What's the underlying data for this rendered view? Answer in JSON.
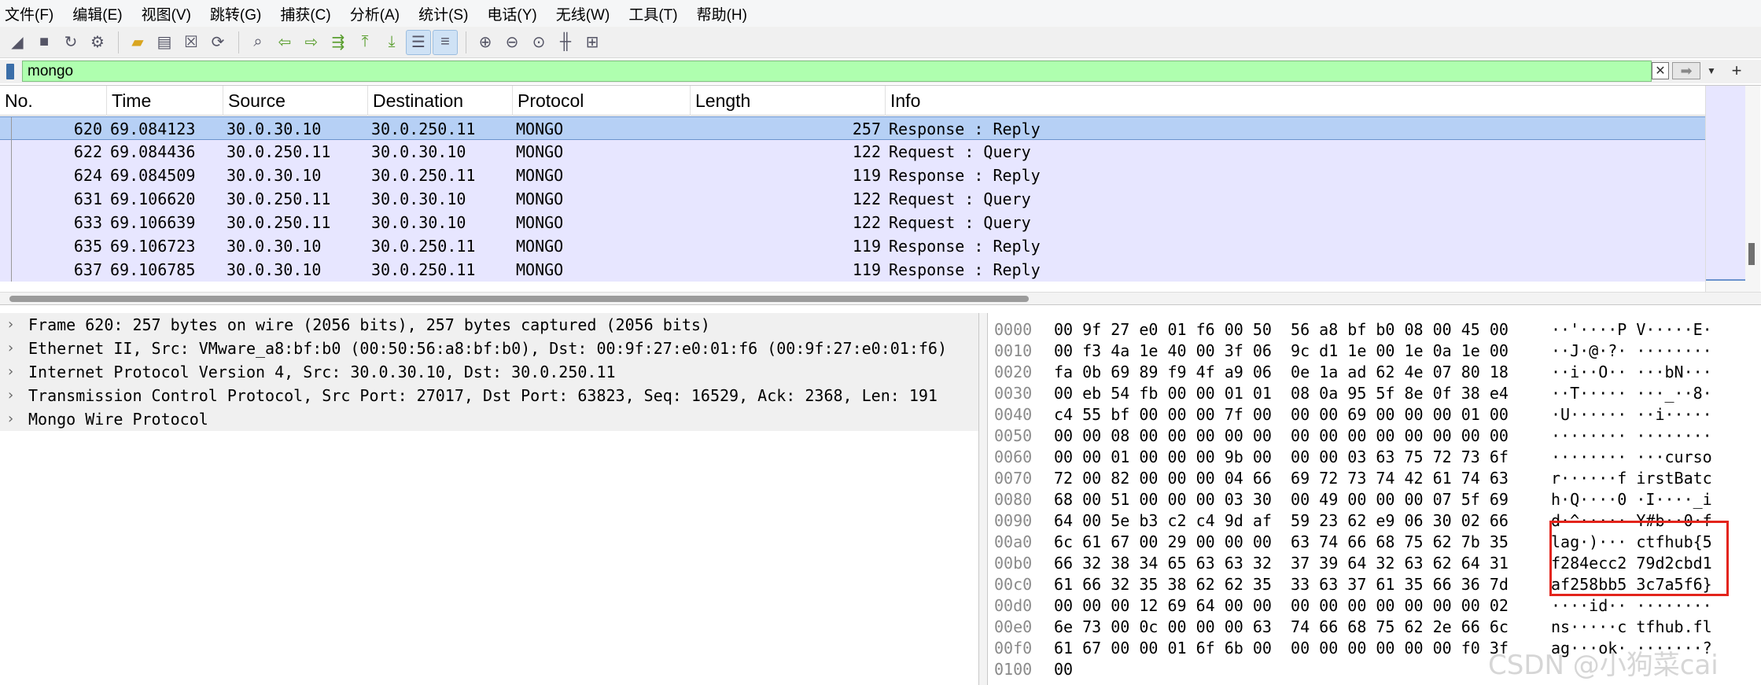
{
  "menubar": {
    "items": [
      "文件(F)",
      "编辑(E)",
      "视图(V)",
      "跳转(G)",
      "捕获(C)",
      "分析(A)",
      "统计(S)",
      "电话(Y)",
      "无线(W)",
      "工具(T)",
      "帮助(H)"
    ]
  },
  "toolbar": {
    "icons": [
      "shark-fin-icon",
      "stop-icon",
      "restart-icon",
      "capture-options-icon",
      "folder-open-icon",
      "file-icon",
      "close-file-icon",
      "reload-icon",
      "search-icon",
      "go-back-icon",
      "go-forward-icon",
      "go-to-packet-icon",
      "first-packet-icon",
      "last-packet-icon",
      "autoscroll-icon",
      "colorize-icon",
      "zoom-in-icon",
      "zoom-out-icon",
      "zoom-normal-icon",
      "resize-columns-icon",
      "layout-icon"
    ]
  },
  "filter": {
    "value": "mongo"
  },
  "packet_list": {
    "columns": [
      "No.",
      "Time",
      "Source",
      "Destination",
      "Protocol",
      "Length",
      "Info"
    ],
    "rows": [
      {
        "no": "620",
        "time": "69.084123",
        "src": "30.0.30.10",
        "dst": "30.0.250.11",
        "proto": "MONGO",
        "len": "257",
        "info": "Response : Reply"
      },
      {
        "no": "622",
        "time": "69.084436",
        "src": "30.0.250.11",
        "dst": "30.0.30.10",
        "proto": "MONGO",
        "len": "122",
        "info": "Request : Query"
      },
      {
        "no": "624",
        "time": "69.084509",
        "src": "30.0.30.10",
        "dst": "30.0.250.11",
        "proto": "MONGO",
        "len": "119",
        "info": "Response : Reply"
      },
      {
        "no": "631",
        "time": "69.106620",
        "src": "30.0.250.11",
        "dst": "30.0.30.10",
        "proto": "MONGO",
        "len": "122",
        "info": "Request : Query"
      },
      {
        "no": "633",
        "time": "69.106639",
        "src": "30.0.250.11",
        "dst": "30.0.30.10",
        "proto": "MONGO",
        "len": "122",
        "info": "Request : Query"
      },
      {
        "no": "635",
        "time": "69.106723",
        "src": "30.0.30.10",
        "dst": "30.0.250.11",
        "proto": "MONGO",
        "len": "119",
        "info": "Response : Reply"
      },
      {
        "no": "637",
        "time": "69.106785",
        "src": "30.0.30.10",
        "dst": "30.0.250.11",
        "proto": "MONGO",
        "len": "119",
        "info": "Response : Reply"
      }
    ]
  },
  "details": {
    "items": [
      "Frame 620: 257 bytes on wire (2056 bits), 257 bytes captured (2056 bits)",
      "Ethernet II, Src: VMware_a8:bf:b0 (00:50:56:a8:bf:b0), Dst: 00:9f:27:e0:01:f6 (00:9f:27:e0:01:f6)",
      "Internet Protocol Version 4, Src: 30.0.30.10, Dst: 30.0.250.11",
      "Transmission Control Protocol, Src Port: 27017, Dst Port: 63823, Seq: 16529, Ack: 2368, Len: 191",
      "Mongo Wire Protocol"
    ]
  },
  "hex": {
    "rows": [
      {
        "off": "0000",
        "bytes": "00 9f 27 e0 01 f6 00 50  56 a8 bf b0 08 00 45 00",
        "ascii": "··'····P V·····E·"
      },
      {
        "off": "0010",
        "bytes": "00 f3 4a 1e 40 00 3f 06  9c d1 1e 00 1e 0a 1e 00",
        "ascii": "··J·@·?· ········"
      },
      {
        "off": "0020",
        "bytes": "fa 0b 69 89 f9 4f a9 06  0e 1a ad 62 4e 07 80 18",
        "ascii": "··i··O·· ···bN···"
      },
      {
        "off": "0030",
        "bytes": "00 eb 54 fb 00 00 01 01  08 0a 95 5f 8e 0f 38 e4",
        "ascii": "··T····· ···_··8·"
      },
      {
        "off": "0040",
        "bytes": "c4 55 bf 00 00 00 7f 00  00 00 69 00 00 00 01 00",
        "ascii": "·U······ ··i·····"
      },
      {
        "off": "0050",
        "bytes": "00 00 08 00 00 00 00 00  00 00 00 00 00 00 00 00",
        "ascii": "········ ········"
      },
      {
        "off": "0060",
        "bytes": "00 00 01 00 00 00 9b 00  00 00 03 63 75 72 73 6f",
        "ascii": "········ ···curso"
      },
      {
        "off": "0070",
        "bytes": "72 00 82 00 00 00 04 66  69 72 73 74 42 61 74 63",
        "ascii": "r······f irstBatc"
      },
      {
        "off": "0080",
        "bytes": "68 00 51 00 00 00 03 30  00 49 00 00 00 07 5f 69",
        "ascii": "h·Q····0 ·I····_i"
      },
      {
        "off": "0090",
        "bytes": "64 00 5e b3 c2 c4 9d af  59 23 62 e9 06 30 02 66",
        "ascii": "d·^····· Y#b··0·f"
      },
      {
        "off": "00a0",
        "bytes": "6c 61 67 00 29 00 00 00  63 74 66 68 75 62 7b 35",
        "ascii": "lag·)··· ctfhub{5"
      },
      {
        "off": "00b0",
        "bytes": "66 32 38 34 65 63 63 32  37 39 64 32 63 62 64 31",
        "ascii": "f284ecc2 79d2cbd1"
      },
      {
        "off": "00c0",
        "bytes": "61 66 32 35 38 62 62 35  33 63 37 61 35 66 36 7d",
        "ascii": "af258bb5 3c7a5f6}"
      },
      {
        "off": "00d0",
        "bytes": "00 00 00 12 69 64 00 00  00 00 00 00 00 00 00 02",
        "ascii": "····id·· ········"
      },
      {
        "off": "00e0",
        "bytes": "6e 73 00 0c 00 00 00 63  74 66 68 75 62 2e 66 6c",
        "ascii": "ns·····c tfhub.fl"
      },
      {
        "off": "00f0",
        "bytes": "61 67 00 00 01 6f 6b 00  00 00 00 00 00 00 f0 3f",
        "ascii": "ag···ok· ·······?"
      },
      {
        "off": "0100",
        "bytes": "00",
        "ascii": ""
      }
    ]
  },
  "watermark": "CSDN @小狗菜cai",
  "colors": {
    "filter_bg": "#afffaf",
    "row_bg": "#e7e6ff",
    "selected_row_bg": "#b6d0f5",
    "highlight_box": "#e3241b"
  }
}
